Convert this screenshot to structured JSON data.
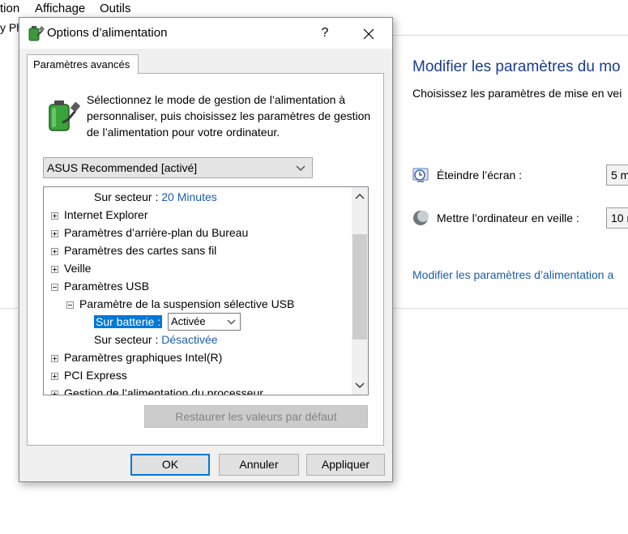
{
  "menubar": {
    "items": [
      "tion",
      "Affichage",
      "Outils"
    ],
    "left_fragment": "y Ph"
  },
  "background": {
    "heading": "Modifier les paramètres du mo",
    "subtitle": "Choisissez les paramètres de mise en vei",
    "rows": [
      {
        "label": "Éteindre l’écran :",
        "value": "5 m",
        "icon": "display-clock-icon"
      },
      {
        "label": "Mettre l’ordinateur en veille :",
        "value": "10 m",
        "icon": "moon-icon"
      }
    ],
    "link": "Modifier les paramètres d’alimentation a"
  },
  "dialog": {
    "title": "Options d’alimentation",
    "help": "?",
    "tab_label": "Paramètres avancés",
    "intro": "Sélectionnez le mode de gestion de l’alimentation à personnaliser, puis choisissez les paramètres de gestion de l’alimentation pour votre ordinateur.",
    "plan_select": "ASUS Recommended [activé]",
    "tree": {
      "items": [
        {
          "label": "Sur secteur :",
          "value": "20 Minutes"
        },
        {
          "label": "Internet Explorer"
        },
        {
          "label": "Paramètres d’arrière-plan du Bureau"
        },
        {
          "label": "Paramètres des cartes sans fil"
        },
        {
          "label": "Veille"
        },
        {
          "label": "Paramètres USB"
        },
        {
          "label": "Paramètre de la suspension sélective USB"
        },
        {
          "label": "Sur batterie :",
          "value": "Activée"
        },
        {
          "label": "Sur secteur :",
          "value": "Désactivée"
        },
        {
          "label": "Paramètres graphiques Intel(R)"
        },
        {
          "label": "PCI Express"
        },
        {
          "label": "Gestion de l’alimentation du processeur"
        }
      ]
    },
    "restore_button": "Restaurer les valeurs par défaut",
    "ok_button": "OK",
    "cancel_button": "Annuler",
    "apply_button": "Appliquer"
  },
  "colors": {
    "accent": "#0078d7",
    "link": "#1a5dab",
    "heading": "#1a3d8f"
  }
}
